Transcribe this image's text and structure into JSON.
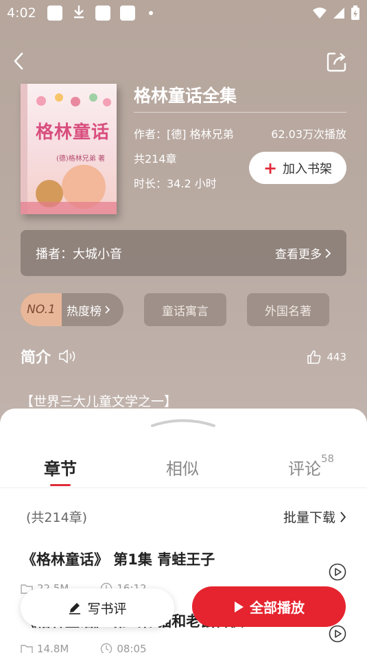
{
  "status_bar": {
    "time": "4:02"
  },
  "book": {
    "title": "格林童话全集",
    "author": "作者：[德] 格林兄弟",
    "plays": "62.03万次播放",
    "chapters": "共214章",
    "duration": "时长：34.2 小时",
    "add_shelf_label": "加入书架",
    "cover_title": "格林童话",
    "cover_subtitle": "(德)格林兄弟 著"
  },
  "narrator": {
    "label": "播者：大城小音",
    "more": "查看更多"
  },
  "tags": {
    "rank_badge": "NO.1",
    "rank_label": "热度榜",
    "items": [
      "童话寓言",
      "外国名著"
    ]
  },
  "intro": {
    "heading": "简介",
    "likes": "443",
    "text": "【世界三大儿童文学之一】"
  },
  "sheet": {
    "tabs": [
      {
        "label": "章节"
      },
      {
        "label": "相似"
      },
      {
        "label": "评论",
        "badge": "58"
      }
    ],
    "count": "(共214章)",
    "batch_download": "批量下载",
    "episodes": [
      {
        "title": "《格林童话》 第1集 青蛙王子",
        "size": "22.5M",
        "duration": "16:12"
      },
      {
        "title": "《格林童话》 第2集 猫和老鼠合伙",
        "size": "14.8M",
        "duration": "08:05"
      }
    ]
  },
  "actions": {
    "review": "写书评",
    "play_all": "全部播放"
  }
}
